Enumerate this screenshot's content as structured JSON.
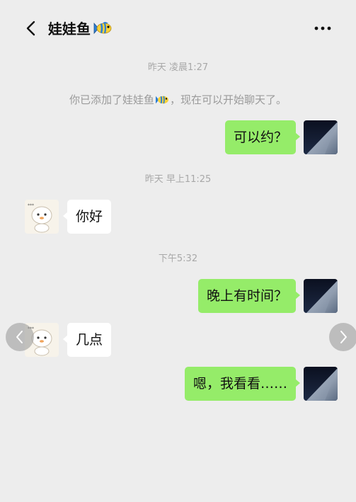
{
  "header": {
    "title": "娃娃鱼"
  },
  "messages": [
    {
      "kind": "timestamp",
      "text": "昨天 凌晨1:27"
    },
    {
      "kind": "system",
      "text_before": "你已添加了娃娃鱼",
      "text_after": "，现在可以开始聊天了。"
    },
    {
      "kind": "chat",
      "from": "me",
      "text": "可以约？"
    },
    {
      "kind": "timestamp",
      "text": "昨天 早上11:25"
    },
    {
      "kind": "chat",
      "from": "peer",
      "text": "你好"
    },
    {
      "kind": "timestamp",
      "text": "下午5:32"
    },
    {
      "kind": "chat",
      "from": "me",
      "text": "晚上有时间？"
    },
    {
      "kind": "chat",
      "from": "peer",
      "text": "几点"
    },
    {
      "kind": "chat",
      "from": "me",
      "text": "嗯，我看看……"
    }
  ],
  "icons": {
    "back": "chevron-left-icon",
    "more": "more-dots-icon",
    "fish_emoji": "tropical-fish-emoji-icon",
    "nav_prev": "chevron-left-icon",
    "nav_next": "chevron-right-icon"
  },
  "colors": {
    "background": "#ededed",
    "my_bubble": "#95ec69",
    "peer_bubble": "#ffffff",
    "timestamp_text": "#a8a8a8"
  }
}
